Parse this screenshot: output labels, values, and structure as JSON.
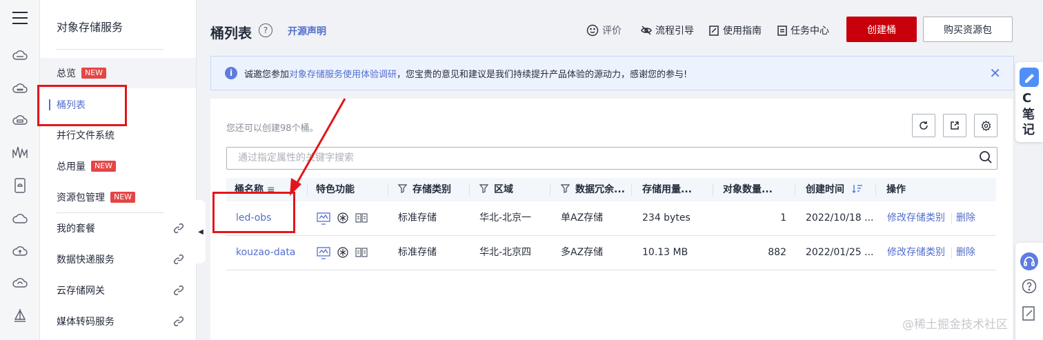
{
  "rail": {
    "icons": [
      "menu-icon",
      "cloud-icon",
      "cloud-dots-icon",
      "cloud-server-icon",
      "wave-icon",
      "device-icon",
      "cloud-outline-icon",
      "cloud-upload-icon",
      "cloud-refresh-icon",
      "sailboat-icon"
    ]
  },
  "nav": {
    "title": "对象存储服务",
    "items": [
      {
        "label": "总览",
        "badge": "NEW"
      },
      {
        "label": "桶列表"
      },
      {
        "label": "并行文件系统"
      },
      {
        "label": "总用量",
        "badge": "NEW"
      },
      {
        "label": "资源包管理",
        "badge": "NEW"
      },
      {
        "label": "我的套餐"
      },
      {
        "label": "数据快递服务"
      },
      {
        "label": "云存储网关"
      },
      {
        "label": "媒体转码服务"
      }
    ]
  },
  "header": {
    "title": "桶列表",
    "help_icon": "?",
    "open_source": "开源声明",
    "tools": {
      "rate": "评价",
      "guide_flow": "流程引导",
      "guide": "使用指南",
      "tasks": "任务中心"
    },
    "create_button": "创建桶",
    "buy_button": "购买资源包"
  },
  "notice": {
    "prefix": "诚邀您参加",
    "link": "对象存储服务使用体验调研",
    "suffix": "，您宝贵的意见和建议是我们持续提升产品体验的源动力，感谢您的参与!"
  },
  "quota_text": "您还可以创建98个桶。",
  "search": {
    "placeholder": "通过指定属性的关键字搜索"
  },
  "table": {
    "columns": [
      "桶名称",
      "特色功能",
      "存储类别",
      "区域",
      "数据冗余...",
      "存储用量...",
      "对象数量...",
      "创建时间",
      "操作"
    ],
    "rows": [
      {
        "name": "led-obs",
        "storage_class": "标准存储",
        "region": "华北-北京一",
        "redundancy": "单AZ存储",
        "usage": "234 bytes",
        "objects": "1",
        "created": "2022/10/18 ...",
        "op_modify": "修改存储类别",
        "op_delete": "删除"
      },
      {
        "name": "kouzao-data",
        "storage_class": "标准存储",
        "region": "华北-北京四",
        "redundancy": "多AZ存储",
        "usage": "10.13 MB",
        "objects": "882",
        "created": "2022/01/25 ...",
        "op_modify": "修改存储类别",
        "op_delete": "删除"
      }
    ]
  },
  "float_note": {
    "line1": "C",
    "line2": "笔",
    "line3": "记"
  },
  "watermark": "@稀土掘金技术社区",
  "colors": {
    "brand_red": "#c7000b",
    "link_blue": "#526ecc",
    "annotation_red": "#e3151a"
  }
}
